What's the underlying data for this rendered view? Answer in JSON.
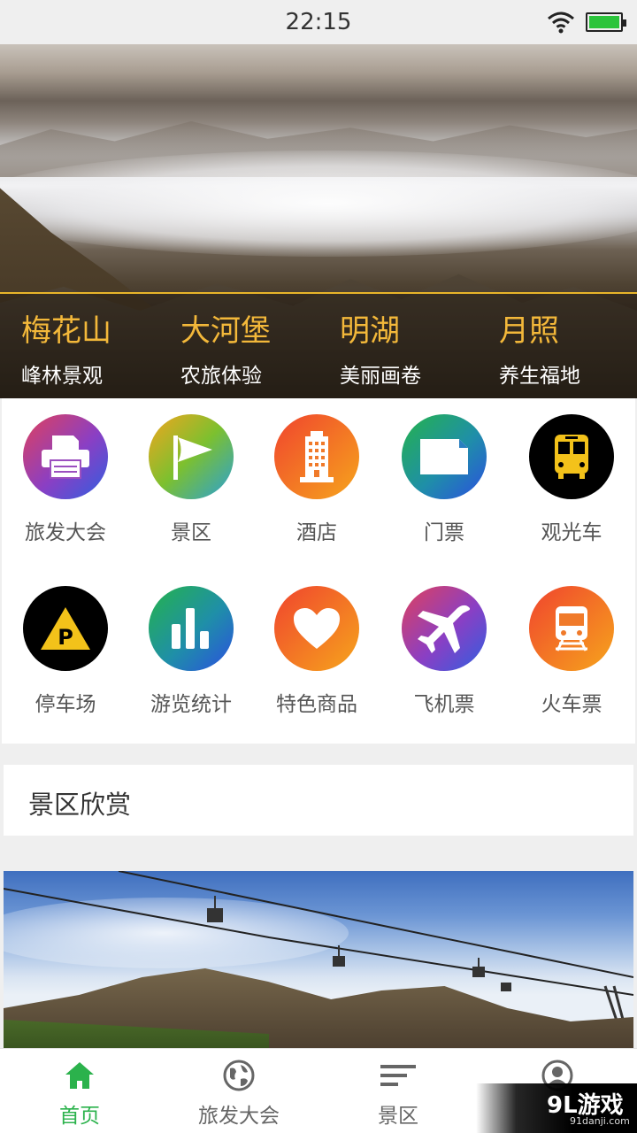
{
  "status_bar": {
    "time": "22:15"
  },
  "hero": {
    "spots": [
      {
        "name": "梅花山",
        "desc": "峰林景观"
      },
      {
        "name": "大河堡",
        "desc": "农旅体验"
      },
      {
        "name": "明湖",
        "desc": "美丽画卷"
      },
      {
        "name": "月照",
        "desc": "养生福地"
      }
    ]
  },
  "grid": {
    "items": [
      {
        "label": "旅发大会",
        "icon": "printer-icon"
      },
      {
        "label": "景区",
        "icon": "flag-icon"
      },
      {
        "label": "酒店",
        "icon": "hotel-building-icon"
      },
      {
        "label": "门票",
        "icon": "ticket-icon"
      },
      {
        "label": "观光车",
        "icon": "bus-icon"
      },
      {
        "label": "停车场",
        "icon": "parking-icon"
      },
      {
        "label": "游览统计",
        "icon": "bar-chart-icon"
      },
      {
        "label": "特色商品",
        "icon": "heart-icon"
      },
      {
        "label": "飞机票",
        "icon": "airplane-icon"
      },
      {
        "label": "火车票",
        "icon": "train-icon"
      }
    ]
  },
  "section": {
    "title": "景区欣赏"
  },
  "tabbar": {
    "tabs": [
      {
        "label": "首页",
        "icon": "home-icon",
        "active": true
      },
      {
        "label": "旅发大会",
        "icon": "globe-icon",
        "active": false
      },
      {
        "label": "景区",
        "icon": "list-icon",
        "active": false
      },
      {
        "label": "",
        "icon": "user-icon",
        "active": false
      }
    ]
  },
  "watermark": {
    "text": "9L游戏",
    "sub": "91danji.com"
  },
  "colors": {
    "accent_green": "#2bb24c",
    "hero_gold": "#f3b83a"
  }
}
